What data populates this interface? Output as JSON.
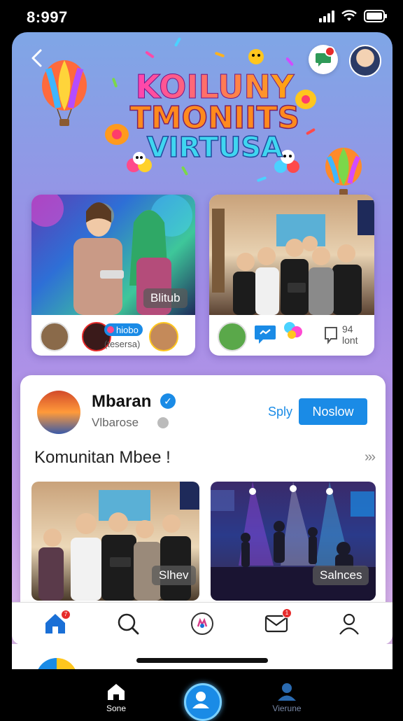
{
  "status_bar": {
    "time": "8:997"
  },
  "hero": {
    "title_line1": "KOILUNY",
    "title_line2": "TMONIITS",
    "title_line3": "VIRTUSA"
  },
  "card_left": {
    "photo_tag": "Blitub",
    "badge_label": "hiobo",
    "sub_label": "(tesersa)"
  },
  "card_right": {
    "count": "94",
    "count_label": "lont"
  },
  "feed": {
    "name": "Mbaran",
    "subtitle": "Vlbarose",
    "reply_label": "Sply",
    "follow_label": "Noslow",
    "community_title": "Komunitan Mbee !",
    "more_label": "›››",
    "photo_left_tag": "Slhev",
    "photo_right_tag": "Salnces"
  },
  "tabbar": {
    "home_badge": "7",
    "mail_badge": "1"
  },
  "bottom_nav": {
    "left_label": "Sone",
    "right_label": "Vierune"
  },
  "colors": {
    "accent": "#1a8be6",
    "badge": "#e62b2b"
  }
}
